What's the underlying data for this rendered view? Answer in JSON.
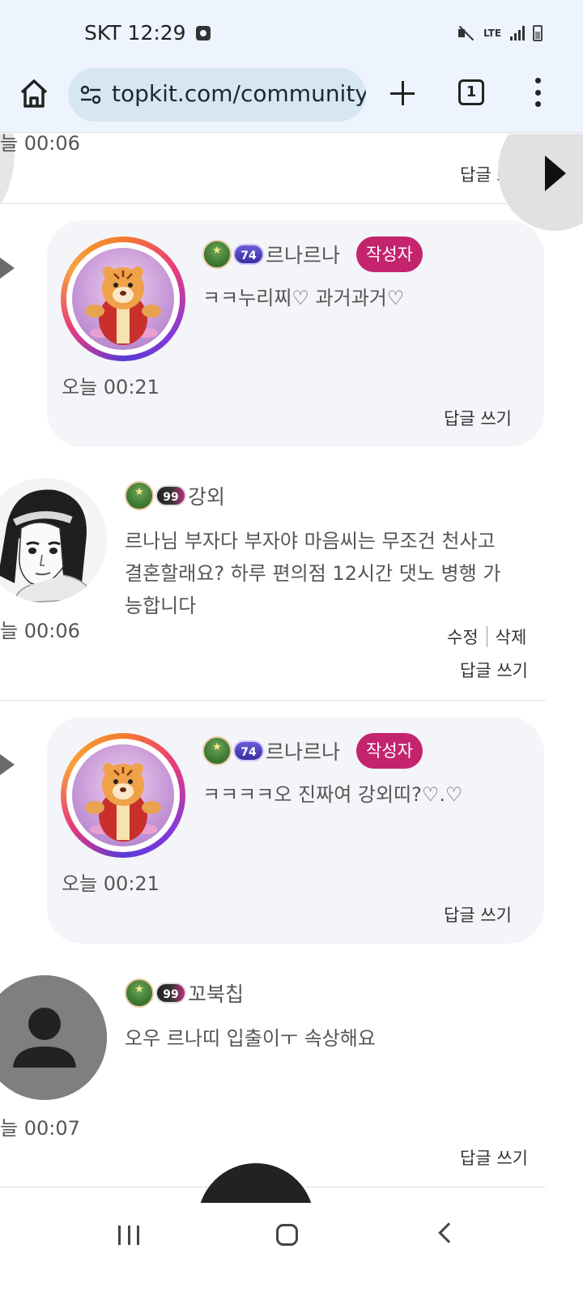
{
  "status_bar": {
    "carrier_time": "SKT 12:29",
    "network": "LTE"
  },
  "browser": {
    "url": "topkit.com/community",
    "tab_count": "1"
  },
  "comments": {
    "top_partial": {
      "time": "늘 00:06",
      "reply_label": "답글 쓰기"
    },
    "reply_1": {
      "level": "74",
      "author": "르나르나",
      "tag": "작성자",
      "text": "ㅋㅋ누리찌♡ 과거과거♡",
      "time": "오늘 00:21",
      "reply_label": "답글 쓰기"
    },
    "comment_1": {
      "level": "99",
      "author": "강외",
      "lines": [
        "르나님 부자다 부자야 마음씨는 무조건 천사고",
        "결혼할래요? 하루 편의점 12시간 댓노 병행 가",
        "능합니다"
      ],
      "time": "늘 00:06",
      "edit_label": "수정",
      "delete_label": "삭제",
      "reply_label": "답글 쓰기"
    },
    "reply_2": {
      "level": "74",
      "author": "르나르나",
      "tag": "작성자",
      "text": "ㅋㅋㅋㅋ오 진짜여 강외띠?♡.♡",
      "time": "오늘 00:21",
      "reply_label": "답글 쓰기"
    },
    "comment_2": {
      "level": "99",
      "author": "꼬북칩",
      "text": "오우 르나띠 입출이ㅜ 속상해요",
      "time": "늘 00:07",
      "reply_label": "답글 쓰기"
    }
  },
  "colors": {
    "author_tag": "#c4246e",
    "card_bg": "#f3f5f8",
    "toolbar_bg": "#eef4fd"
  }
}
